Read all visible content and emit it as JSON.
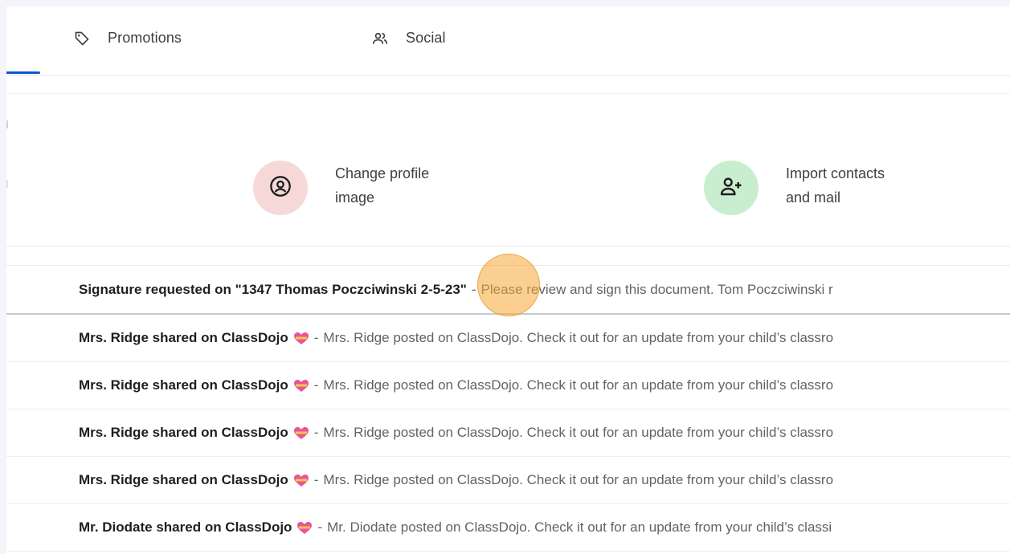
{
  "tabs": [
    {
      "label": "Promotions",
      "icon": "tag-icon"
    },
    {
      "label": "Social",
      "icon": "people-icon"
    }
  ],
  "setup": {
    "profile": {
      "line1": "Change profile",
      "line2": "image",
      "icon": "account-circle-icon",
      "color": "#f7d8d8"
    },
    "import": {
      "line1": "Import contacts",
      "line2": "and mail",
      "icon": "person-add-icon",
      "color": "#c9eecf"
    }
  },
  "emails": [
    {
      "subject": "Signature requested on \"1347 Thomas Poczciwinski 2-5-23\"",
      "snippet": "Please review and sign this document. Tom Poczciwinski r",
      "emoji": false
    },
    {
      "subject": "Mrs. Ridge shared on ClassDojo",
      "snippet": "Mrs. Ridge posted on ClassDojo. Check it out for an update from your child’s classro",
      "emoji": true
    },
    {
      "subject": "Mrs. Ridge shared on ClassDojo",
      "snippet": "Mrs. Ridge posted on ClassDojo. Check it out for an update from your child’s classro",
      "emoji": true
    },
    {
      "subject": "Mrs. Ridge shared on ClassDojo",
      "snippet": "Mrs. Ridge posted on ClassDojo. Check it out for an update from your child’s classro",
      "emoji": true
    },
    {
      "subject": "Mrs. Ridge shared on ClassDojo",
      "snippet": "Mrs. Ridge posted on ClassDojo. Check it out for an update from your child’s classro",
      "emoji": true
    },
    {
      "subject": "Mr. Diodate shared on ClassDojo",
      "snippet": "Mr. Diodate posted on ClassDojo. Check it out for an update from your child’s classi",
      "emoji": true
    }
  ],
  "separator": "-",
  "colors": {
    "accent": "#0b57d0",
    "highlight": "#f6a834"
  }
}
